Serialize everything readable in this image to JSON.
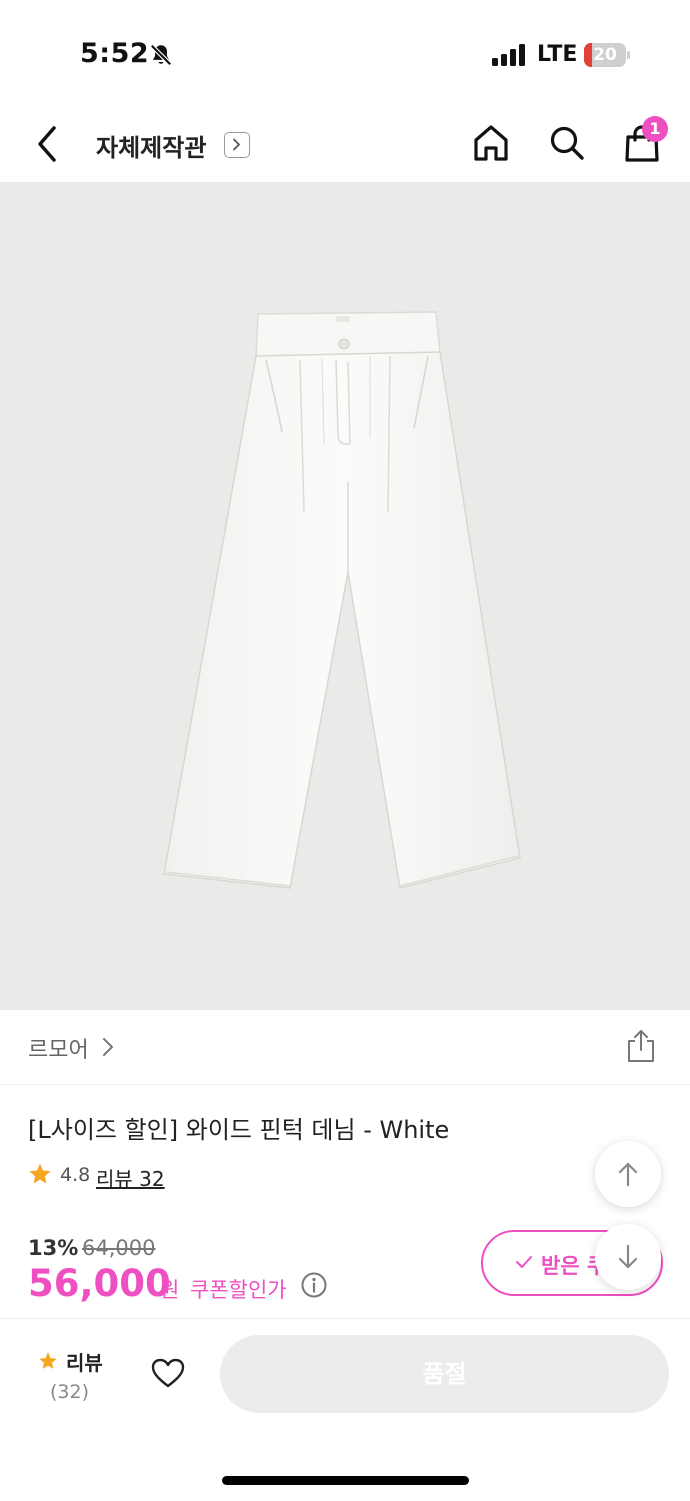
{
  "status_bar": {
    "time": "5:52",
    "network": "LTE",
    "battery": "20",
    "battery_level": 0.2,
    "battery_color": "#e4403a"
  },
  "nav": {
    "title": "자체제작관",
    "cart_count": "1"
  },
  "product": {
    "brand": "르모어",
    "title": "[L사이즈 할인] 와이드 핀턱 데님 - White",
    "rating": "4.8",
    "review_link": "리뷰 32",
    "discount_rate": "13%",
    "original_price": "64,000",
    "price": "56,000",
    "currency": "원",
    "coupon_price_label": "쿠폰할인가",
    "coupon_button": "받은 쿠"
  },
  "bottom_bar": {
    "review_label": "리뷰",
    "review_count": "(32)",
    "action_button": "품절"
  },
  "colors": {
    "accent": "#ee4fc1",
    "star": "#f5a623",
    "image_background": "#ebeae8"
  },
  "icons": [
    "bell-off-icon",
    "signal-icon",
    "battery-icon",
    "back-arrow-icon",
    "chevron-right-icon",
    "home-icon",
    "search-icon",
    "shopping-bag-icon",
    "share-icon",
    "star-icon",
    "info-icon",
    "check-icon",
    "arrow-up-icon",
    "arrow-down-icon",
    "heart-icon"
  ]
}
